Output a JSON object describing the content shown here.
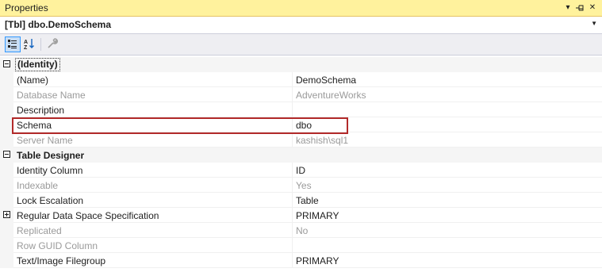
{
  "window": {
    "title": "Properties"
  },
  "object_selector": {
    "label": "[Tbl] dbo.DemoSchema"
  },
  "toolbar": {
    "buttons": [
      "categorized-icon",
      "alphabetical-icon",
      "property-pages-icon"
    ]
  },
  "categories": [
    {
      "name": "(Identity)",
      "properties": [
        {
          "name": "(Name)",
          "value": "DemoSchema"
        },
        {
          "name": "Database Name",
          "value": "AdventureWorks"
        },
        {
          "name": "Description",
          "value": ""
        },
        {
          "name": "Schema",
          "value": "dbo"
        },
        {
          "name": "Server Name",
          "value": "kashish\\sql1"
        }
      ]
    },
    {
      "name": "Table Designer",
      "properties": [
        {
          "name": "Identity Column",
          "value": "ID"
        },
        {
          "name": "Indexable",
          "value": "Yes"
        },
        {
          "name": "Lock Escalation",
          "value": "Table"
        },
        {
          "name": "Regular Data Space Specification",
          "value": "PRIMARY"
        },
        {
          "name": "Replicated",
          "value": "No"
        },
        {
          "name": "Row GUID Column",
          "value": ""
        },
        {
          "name": "Text/Image Filegroup",
          "value": "PRIMARY"
        }
      ]
    }
  ],
  "colors": {
    "titlebar_bg": "#fff29d",
    "highlight_border": "#b22a2a",
    "readonly_text": "#9a9a9a"
  }
}
